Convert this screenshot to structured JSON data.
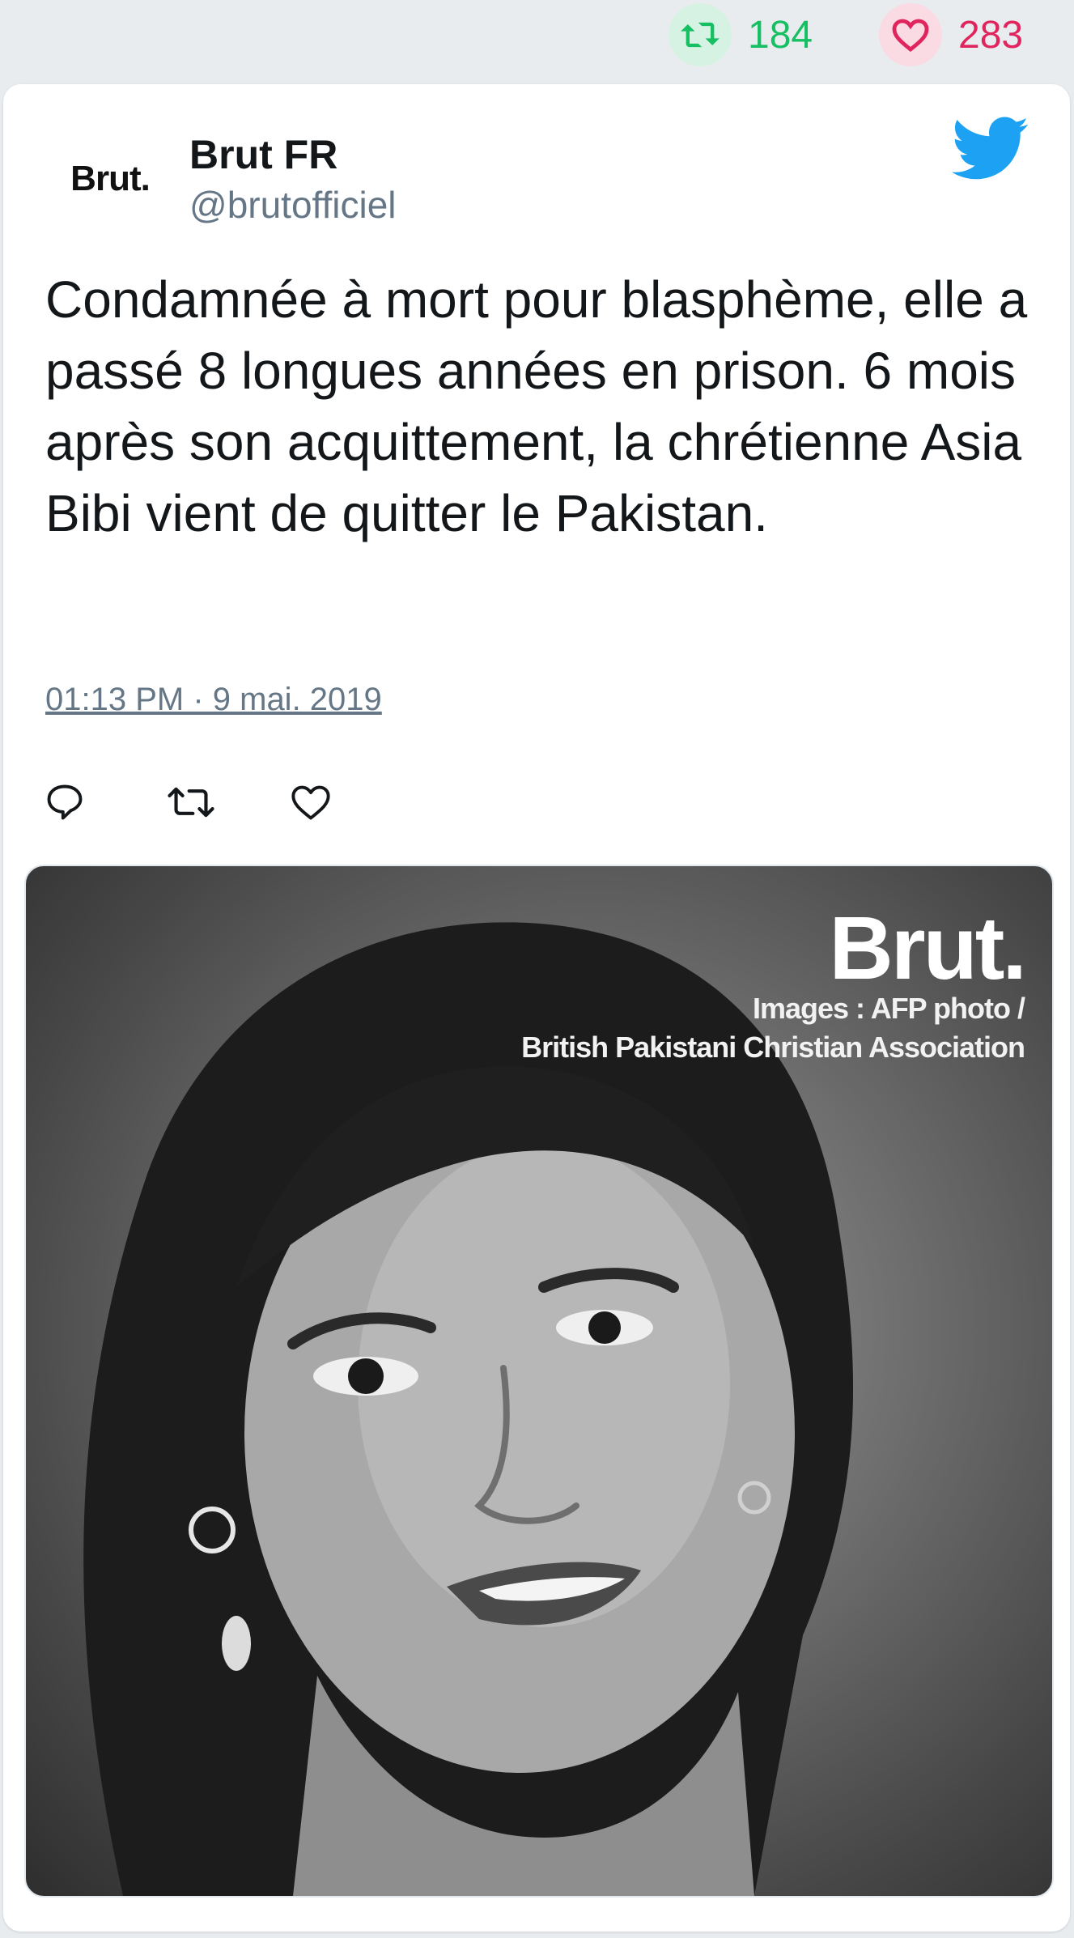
{
  "stats": {
    "retweet_count": "184",
    "like_count": "283",
    "retweet_icon": "retweet-icon",
    "like_icon": "heart-icon",
    "retweet_color": "#17bf63",
    "like_color": "#e0245e"
  },
  "tweet": {
    "avatar_text": "Brut.",
    "display_name": "Brut FR",
    "handle": "@brutofficiel",
    "text": "Condamnée à mort pour blasphème, elle a passé 8 longues années en prison. 6 mois après son acquittement, la chrétienne Asia Bibi vient de quitter le Pakistan.",
    "timestamp": "01:13 PM · 9 mai. 2019",
    "brand_color": "#1da1f2",
    "actions": [
      {
        "name": "reply",
        "icon": "reply-icon"
      },
      {
        "name": "retweet",
        "icon": "retweet-icon"
      },
      {
        "name": "like",
        "icon": "heart-icon"
      }
    ]
  },
  "media": {
    "brand": "Brut.",
    "credit_line1": "Images : AFP photo /",
    "credit_line2": "British Pakistani Christian Association"
  }
}
